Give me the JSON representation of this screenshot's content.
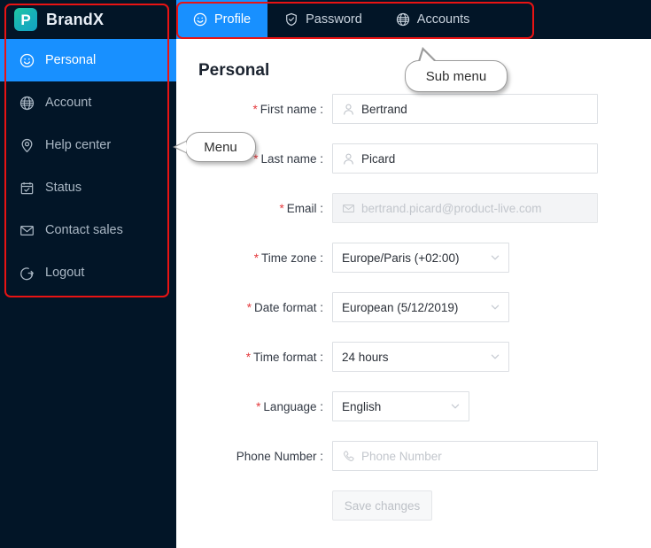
{
  "brand": {
    "logo_letter": "P",
    "name": "BrandX"
  },
  "sidebar": {
    "items": [
      {
        "label": "Personal",
        "icon": "smiley-icon",
        "active": true
      },
      {
        "label": "Account",
        "icon": "globe-icon",
        "active": false
      },
      {
        "label": "Help center",
        "icon": "map-pin-icon",
        "active": false
      },
      {
        "label": "Status",
        "icon": "calendar-check-icon",
        "active": false
      },
      {
        "label": "Contact sales",
        "icon": "envelope-icon",
        "active": false
      },
      {
        "label": "Logout",
        "icon": "logout-icon",
        "active": false
      }
    ]
  },
  "tabs": [
    {
      "label": "Profile",
      "icon": "smiley-icon",
      "active": true
    },
    {
      "label": "Password",
      "icon": "shield-check-icon",
      "active": false
    },
    {
      "label": "Accounts",
      "icon": "globe-icon",
      "active": false
    }
  ],
  "page": {
    "title": "Personal"
  },
  "form": {
    "required_mark": "*",
    "fields": [
      {
        "label": "First name :",
        "value": "Bertrand",
        "placeholder": "",
        "icon": "user-icon",
        "type": "text",
        "required": true,
        "disabled": false,
        "width": "w300"
      },
      {
        "label": "Last name :",
        "value": "Picard",
        "placeholder": "",
        "icon": "user-icon",
        "type": "text",
        "required": true,
        "disabled": false,
        "width": "w300"
      },
      {
        "label": "Email :",
        "value": "",
        "placeholder": "bertrand.picard@product-live.com",
        "icon": "envelope-icon",
        "type": "text",
        "required": true,
        "disabled": true,
        "width": "w300"
      },
      {
        "label": "Time zone :",
        "value": "Europe/Paris (+02:00)",
        "placeholder": "",
        "icon": "",
        "type": "select",
        "required": true,
        "disabled": false,
        "width": "w200"
      },
      {
        "label": "Date format :",
        "value": "European (5/12/2019)",
        "placeholder": "",
        "icon": "",
        "type": "select",
        "required": true,
        "disabled": false,
        "width": "w200"
      },
      {
        "label": "Time format :",
        "value": "24 hours",
        "placeholder": "",
        "icon": "",
        "type": "select",
        "required": true,
        "disabled": false,
        "width": "w200"
      },
      {
        "label": "Language :",
        "value": "English",
        "placeholder": "",
        "icon": "",
        "type": "select",
        "required": true,
        "disabled": false,
        "width": "w155"
      },
      {
        "label": "Phone Number :",
        "value": "",
        "placeholder": "Phone Number",
        "icon": "phone-icon",
        "type": "text",
        "required": false,
        "disabled": false,
        "width": "w300"
      }
    ],
    "save_label": "Save changes"
  },
  "annotations": [
    {
      "id": "menu",
      "text": "Menu"
    },
    {
      "id": "submenu",
      "text": "Sub menu"
    }
  ],
  "colors": {
    "sidebar_bg": "#021527",
    "accent": "#1890ff",
    "required": "#e4393c",
    "annotation": "#e81313",
    "logo_gradient_start": "#1fc8a0",
    "logo_gradient_end": "#13a3c4"
  }
}
